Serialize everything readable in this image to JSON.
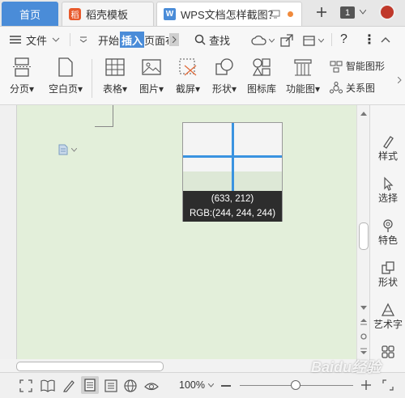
{
  "tabs": {
    "home": "首页",
    "template": "稻壳模板",
    "document": "WPS文档怎样截图？",
    "count": "1"
  },
  "menu": {
    "file": "文件",
    "start": "开始",
    "insert": "插入",
    "page": "页面布",
    "search": "查找"
  },
  "ribbon": {
    "page_break": "分页",
    "blank_page": "空白页",
    "table": "表格",
    "picture": "图片",
    "screenshot": "截屏",
    "shape": "形状",
    "icon_lib": "图标库",
    "function_chart": "功能图",
    "smart_graphic": "智能图形",
    "relation_graph": "关系图"
  },
  "right_panel": {
    "style": "样式",
    "select": "选择",
    "feature": "特色",
    "shape": "形状",
    "art_text": "艺术字"
  },
  "magnifier": {
    "coords": "(633, 212)",
    "rgb": "RGB:(244, 244, 244)"
  },
  "status": {
    "zoom": "100%"
  },
  "watermark": "Baidu经验",
  "colors": {
    "accent": "#4a8cd8",
    "canvas": "#e3efda",
    "crosshair": "#3a93e0"
  }
}
